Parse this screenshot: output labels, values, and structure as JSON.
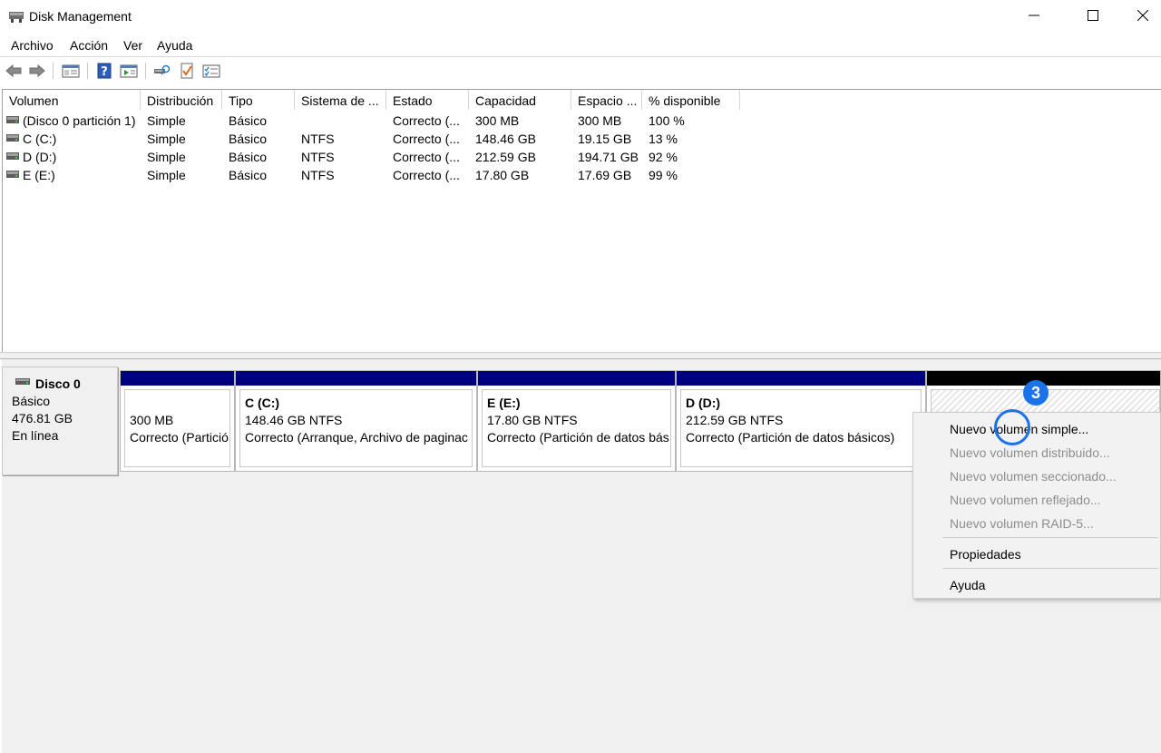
{
  "window": {
    "title": "Disk Management",
    "icon": "disk-management-icon"
  },
  "menu": [
    "Archivo",
    "Acción",
    "Ver",
    "Ayuda"
  ],
  "toolbar": {
    "icons": [
      "back-arrow-icon",
      "forward-arrow-icon",
      "console-tree-icon",
      "help-icon",
      "action-pane-icon",
      "rescan-disks-icon",
      "check-icon",
      "properties-icon"
    ]
  },
  "volume_list": {
    "columns": [
      "Volumen",
      "Distribución",
      "Tipo",
      "Sistema de ...",
      "Estado",
      "Capacidad",
      "Espacio ...",
      "% disponible"
    ],
    "rows": [
      [
        "(Disco 0 partición 1)",
        "Simple",
        "Básico",
        "",
        "Correcto (...",
        "300 MB",
        "300 MB",
        "100 %"
      ],
      [
        "C (C:)",
        "Simple",
        "Básico",
        "NTFS",
        "Correcto (...",
        "148.46 GB",
        "19.15 GB",
        "13 %"
      ],
      [
        "D (D:)",
        "Simple",
        "Básico",
        "NTFS",
        "Correcto (...",
        "212.59 GB",
        "194.71 GB",
        "92 %"
      ],
      [
        "E  (E:)",
        "Simple",
        "Básico",
        "NTFS",
        "Correcto (...",
        "17.80 GB",
        "17.69 GB",
        "99 %"
      ]
    ]
  },
  "disk": {
    "name": "Disco 0",
    "type": "Básico",
    "size": "476.81 GB",
    "status": "En línea"
  },
  "partitions": [
    {
      "title": "",
      "size": "300 MB",
      "status": "Correcto (Partició"
    },
    {
      "title": "C  (C:)",
      "size": "148.46 GB NTFS",
      "status": "Correcto (Arranque, Archivo de paginac"
    },
    {
      "title": "E  (E:)",
      "size": "17.80 GB NTFS",
      "status": "Correcto (Partición de datos bás"
    },
    {
      "title": "D  (D:)",
      "size": "212.59 GB NTFS",
      "status": "Correcto (Partición de datos básicos)"
    }
  ],
  "context_menu": {
    "items": [
      {
        "label": "Nuevo volumen simple...",
        "enabled": true
      },
      {
        "label": "Nuevo volumen distribuido...",
        "enabled": false
      },
      {
        "label": "Nuevo volumen seccionado...",
        "enabled": false
      },
      {
        "label": "Nuevo volumen reflejado...",
        "enabled": false
      },
      {
        "label": "Nuevo volumen RAID-5...",
        "enabled": false
      },
      {
        "label": "Propiedades",
        "enabled": true
      },
      {
        "label": "Ayuda",
        "enabled": true
      }
    ]
  },
  "step_marker": {
    "label": "3",
    "color": "#1a73e8"
  },
  "colors": {
    "partition_bar": "#00007e",
    "unallocated_bar": "#000000",
    "disabled_text": "#8d8d8d"
  }
}
